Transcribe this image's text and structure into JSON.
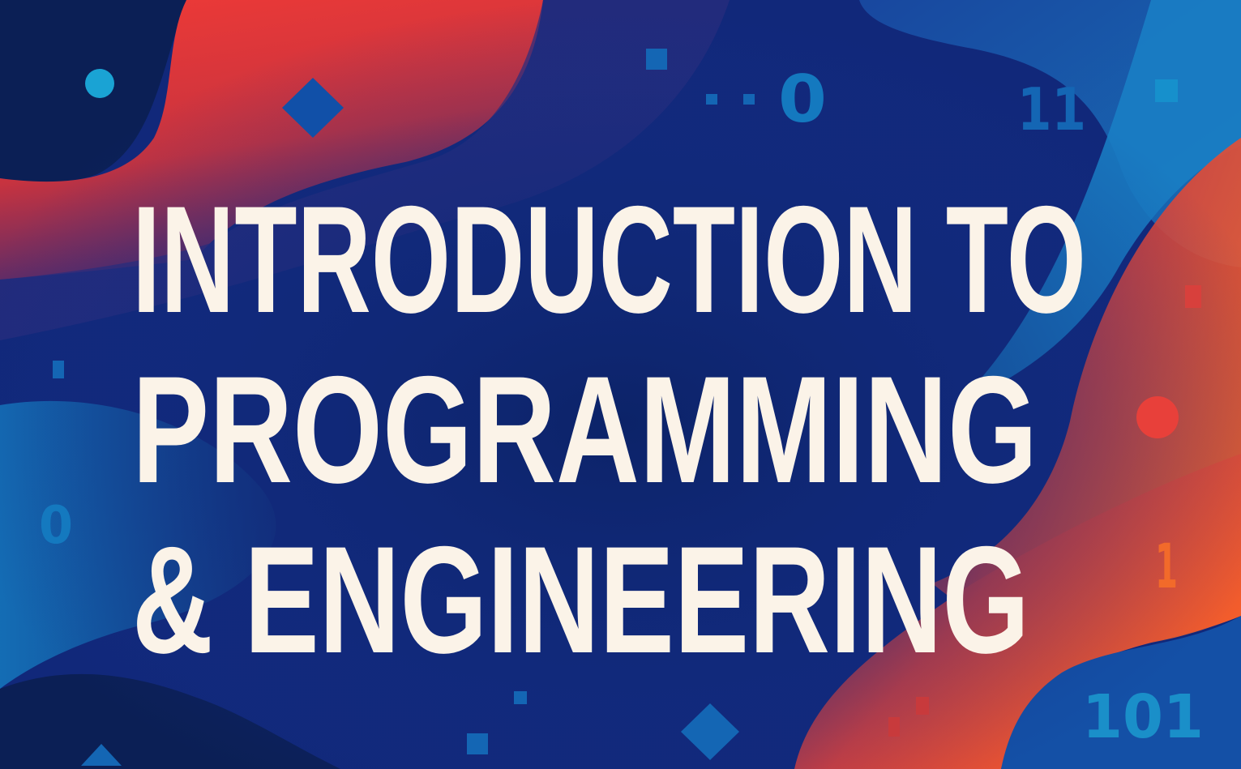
{
  "title": {
    "lines": [
      "INTRODUCTION TO",
      "PROGRAMMING",
      "& ENGINEERING"
    ]
  },
  "decor": {
    "digits": {
      "top_right": "11",
      "top_center": "0",
      "left": "0",
      "right": "1",
      "bottom_right": "101"
    }
  },
  "colors": {
    "background": "#0d2470",
    "navy": "#0b1f55",
    "red": "#ef3b36",
    "orange": "#f2592a",
    "purple": "#4a2f7a",
    "blue": "#1150a8",
    "cyan": "#1a9fd0",
    "title_text": "#fbf3e8"
  }
}
